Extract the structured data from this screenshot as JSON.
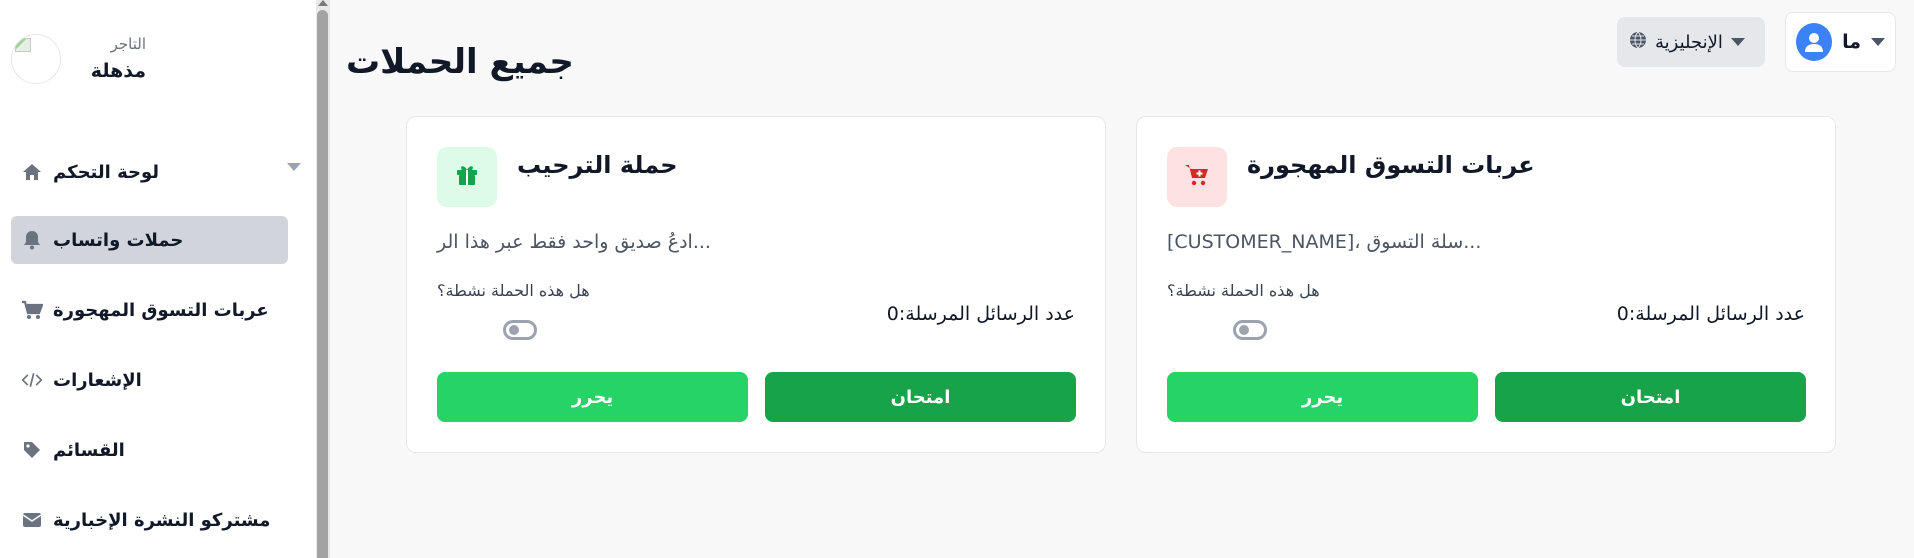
{
  "sidebar": {
    "brand_label": "التاجر",
    "brand_name": "مذهلة",
    "items": [
      {
        "label": "لوحة التحكم",
        "icon": "home-icon"
      },
      {
        "label": "حملات واتساب",
        "icon": "bell-icon",
        "active": true
      },
      {
        "label": "عربات التسوق المهجورة",
        "icon": "cart-icon"
      },
      {
        "label": "الإشعارات",
        "icon": "code-icon"
      },
      {
        "label": "القسائم",
        "icon": "tag-icon"
      },
      {
        "label": "مشتركو النشرة الإخبارية",
        "icon": "mail-icon"
      }
    ]
  },
  "header": {
    "title": "جميع الحملات",
    "language": "الإنجليزية",
    "user": "ما"
  },
  "campaigns": [
    {
      "title": "عربات التسوق المهجورة",
      "icon": "cart-icon",
      "icon_bg": "#fee2e2",
      "icon_color": "#dc2626",
      "description": "[CUSTOMER_NAME]، سلة التسوق...",
      "active_question": "هل هذه الحملة نشطة؟",
      "sent_count_label": "عدد الرسائل المرسلة:",
      "sent_count": "0",
      "test_label": "امتحان",
      "edit_label": "يحرر"
    },
    {
      "title": "حملة الترحيب",
      "icon": "gift-icon",
      "icon_bg": "#dcfce7",
      "icon_color": "#16a34a",
      "description": "ادعُ صديق واحد فقط عبر هذا الر...",
      "active_question": "هل هذه الحملة نشطة؟",
      "sent_count_label": "عدد الرسائل المرسلة:",
      "sent_count": "0",
      "test_label": "امتحان",
      "edit_label": "يحرر"
    }
  ],
  "colors": {
    "primary_green": "#16a34a",
    "whatsapp_green": "#25d366",
    "active_nav_bg": "#d1d5db"
  }
}
